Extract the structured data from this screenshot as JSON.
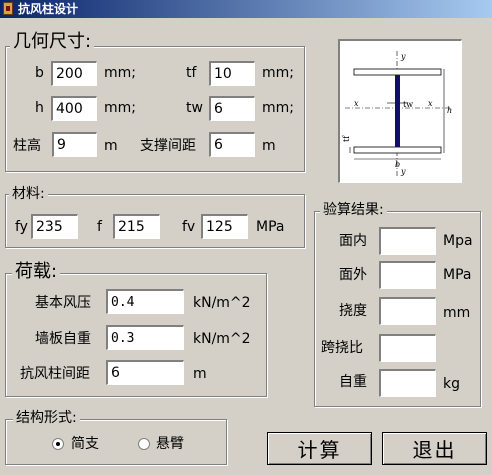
{
  "window": {
    "title": "抗风柱设计"
  },
  "geometry": {
    "title": "几何尺寸:",
    "b": {
      "label": "b",
      "value": "200",
      "unit": "mm;"
    },
    "tf": {
      "label": "tf",
      "value": "10",
      "unit": "mm;"
    },
    "h": {
      "label": "h",
      "value": "400",
      "unit": "mm;"
    },
    "tw": {
      "label": "tw",
      "value": "6",
      "unit": "mm;"
    },
    "height": {
      "label": "柱高",
      "value": "9",
      "unit": "m"
    },
    "brace": {
      "label": "支撑间距",
      "value": "6",
      "unit": "m"
    }
  },
  "material": {
    "title": "材料:",
    "fy": {
      "label": "fy",
      "value": "235"
    },
    "f": {
      "label": "f",
      "value": "215"
    },
    "fv": {
      "label": "fv",
      "value": "125"
    },
    "unit": "MPa"
  },
  "load": {
    "title": "荷载:",
    "wind": {
      "label": "基本风压",
      "value": "0.4",
      "unit": "kN/m^2"
    },
    "wall": {
      "label": "墙板自重",
      "value": "0.3",
      "unit": "kN/m^2"
    },
    "spacing": {
      "label": "抗风柱间距",
      "value": "6",
      "unit": "m"
    }
  },
  "structure": {
    "title": "结构形式:",
    "options": [
      {
        "label": "简支",
        "checked": true
      },
      {
        "label": "悬臂",
        "checked": false
      }
    ]
  },
  "results": {
    "title": "验算结果:",
    "in_plane": {
      "label": "面内",
      "value": "",
      "unit": "Mpa"
    },
    "out_plane": {
      "label": "面外",
      "value": "",
      "unit": "MPa"
    },
    "deflection": {
      "label": "挠度",
      "value": "",
      "unit": "mm"
    },
    "span_ratio": {
      "label": "跨挠比",
      "value": ""
    },
    "self_weight": {
      "label": "自重",
      "value": "",
      "unit": "kg"
    }
  },
  "diagram_labels": {
    "y_top": "y",
    "y_bottom": "y",
    "x_left": "x",
    "x_right": "x",
    "tw": "tw",
    "h": "h",
    "tf": "tf",
    "b": "b"
  },
  "buttons": {
    "calculate": "计算",
    "exit": "退出"
  }
}
